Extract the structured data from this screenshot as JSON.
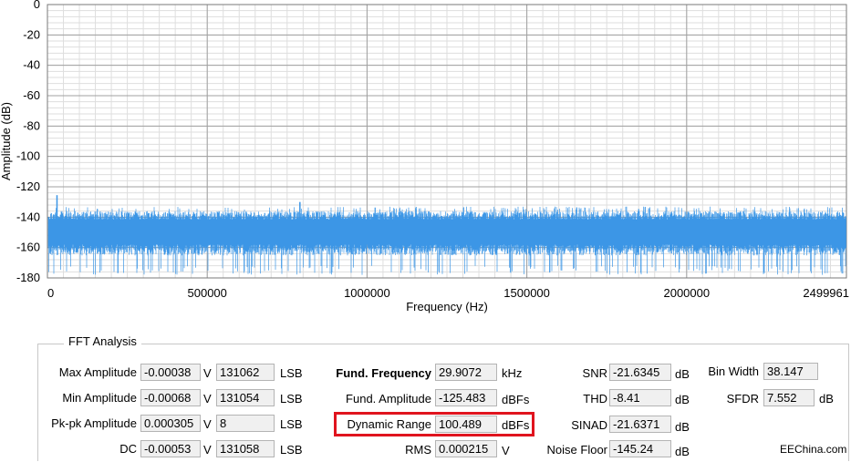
{
  "chart_data": {
    "type": "line",
    "ylabel": "Amplitude (dB)",
    "xlabel": "Frequency (Hz)",
    "ylim": [
      -180,
      0
    ],
    "xlim": [
      0,
      2499961
    ],
    "yticks": [
      "0",
      "-20",
      "-40",
      "-60",
      "-80",
      "-100",
      "-120",
      "-140",
      "-160",
      "-180"
    ],
    "xticks": [
      "0",
      "500000",
      "1000000",
      "1500000",
      "2000000",
      "2499961"
    ],
    "grid": true,
    "series": [
      {
        "color": "#3c96e6",
        "noise_floor_db": -145,
        "noise_low_db": -172,
        "noise_high_db": -133,
        "spikes": [
          {
            "x": 29907,
            "y": -125.5
          },
          {
            "x": 790000,
            "y": -130
          }
        ]
      }
    ]
  },
  "fft": {
    "title": "FFT Analysis",
    "max_amplitude": {
      "label": "Max Amplitude",
      "v": "-0.00038",
      "v_unit": "V",
      "lsb": "131062",
      "lsb_unit": "LSB"
    },
    "min_amplitude": {
      "label": "Min Amplitude",
      "v": "-0.00068",
      "v_unit": "V",
      "lsb": "131054",
      "lsb_unit": "LSB"
    },
    "pkpk_amplitude": {
      "label": "Pk-pk Amplitude",
      "v": "0.000305",
      "v_unit": "V",
      "lsb": "8",
      "lsb_unit": "LSB"
    },
    "dc": {
      "label": "DC",
      "v": "-0.00053",
      "v_unit": "V",
      "lsb": "131058",
      "lsb_unit": "LSB"
    },
    "fund_frequency": {
      "label": "Fund. Frequency",
      "value": "29.9072",
      "unit": "kHz"
    },
    "fund_amplitude": {
      "label": "Fund. Amplitude",
      "value": "-125.483",
      "unit": "dBFs"
    },
    "dynamic_range": {
      "label": "Dynamic Range",
      "value": "100.489",
      "unit": "dBFs"
    },
    "rms": {
      "label": "RMS",
      "value": "0.000215",
      "unit": "V"
    },
    "snr": {
      "label": "SNR",
      "value": "-21.6345",
      "unit": "dB"
    },
    "thd": {
      "label": "THD",
      "value": "-8.41",
      "unit": "dB"
    },
    "sinad": {
      "label": "SINAD",
      "value": "-21.6371",
      "unit": "dB"
    },
    "noise_floor": {
      "label": "Noise Floor",
      "value": "-145.24",
      "unit": "dB"
    },
    "bin_width": {
      "label": "Bin Width",
      "value": "38.147"
    },
    "sfdr": {
      "label": "SFDR",
      "value": "7.552",
      "unit": "dB"
    }
  },
  "watermark": "EEChina.com"
}
